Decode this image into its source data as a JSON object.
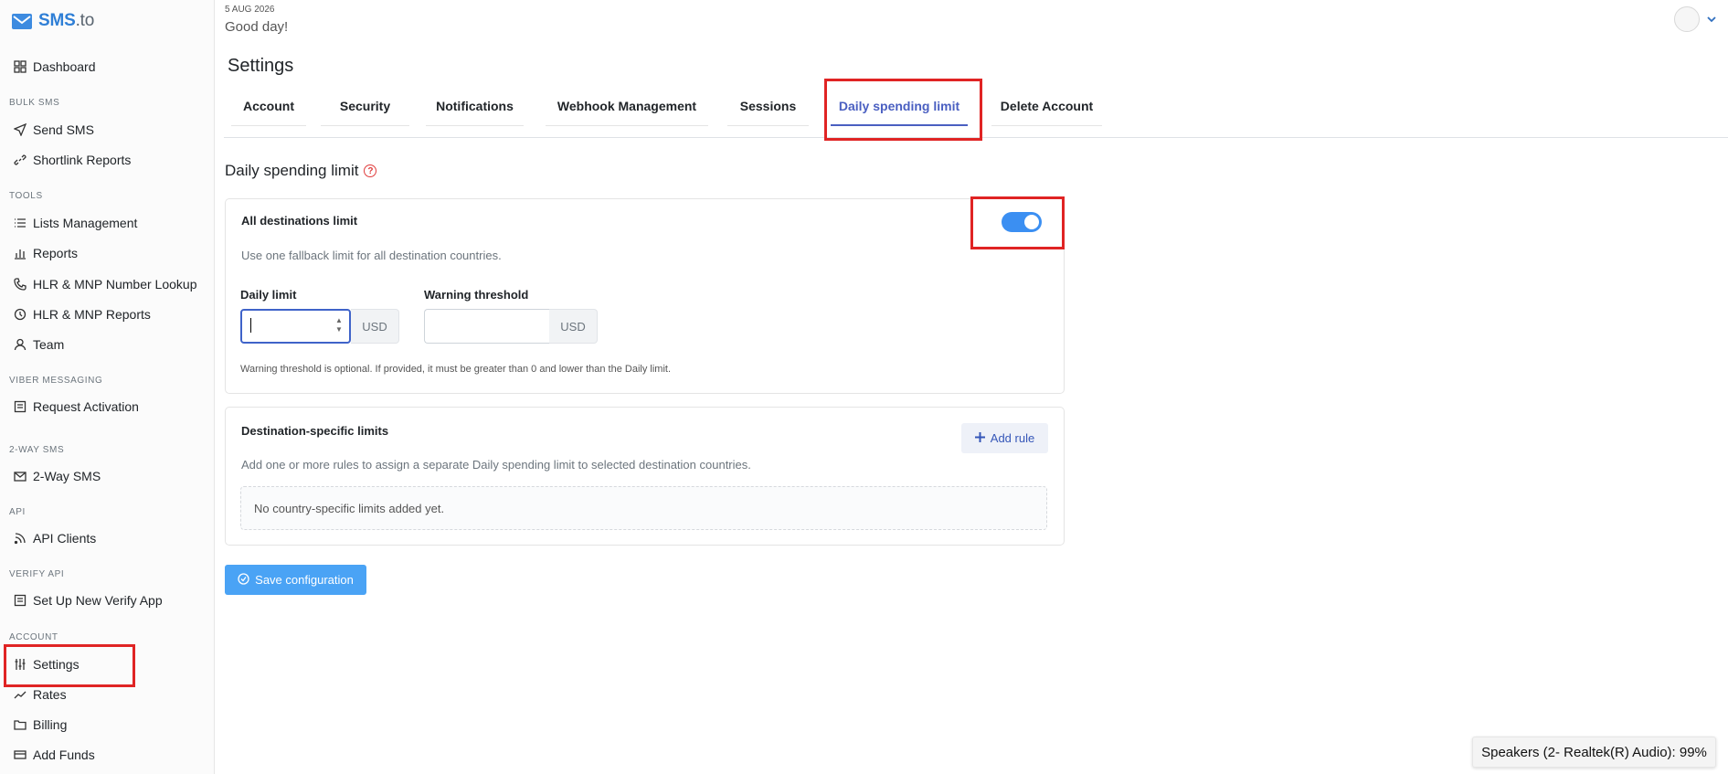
{
  "logo": {
    "brand": "SMS",
    "suffix": ".to",
    "icon": "envelope-icon"
  },
  "sidebar": {
    "dashboard": "Dashboard",
    "sections": {
      "bulk_sms": "BULK SMS",
      "tools": "TOOLS",
      "viber": "VIBER MESSAGING",
      "two_way": "2-WAY SMS",
      "api": "API",
      "verify": "VERIFY API",
      "account": "ACCOUNT"
    },
    "items": {
      "send_sms": "Send SMS",
      "shortlink_reports": "Shortlink Reports",
      "lists_management": "Lists Management",
      "reports": "Reports",
      "hlr_lookup": "HLR & MNP Number Lookup",
      "hlr_reports": "HLR & MNP Reports",
      "team": "Team",
      "request_activation": "Request Activation",
      "two_way_sms": "2-Way SMS",
      "api_clients": "API Clients",
      "verify_app": "Set Up New Verify App",
      "settings": "Settings",
      "rates": "Rates",
      "billing": "Billing",
      "add_funds": "Add Funds"
    }
  },
  "header": {
    "date": "5 AUG 2026",
    "greeting": "Good day!"
  },
  "page": {
    "title": "Settings",
    "tabs": [
      "Account",
      "Security",
      "Notifications",
      "Webhook Management",
      "Sessions",
      "Daily spending limit",
      "Delete Account"
    ],
    "active_tab": "Daily spending limit"
  },
  "spending": {
    "section_title": "Daily spending limit",
    "all_dest": {
      "title": "All destinations limit",
      "description": "Use one fallback limit for all destination countries.",
      "toggle_on": true,
      "daily_limit_label": "Daily limit",
      "daily_limit_value": "",
      "warning_label": "Warning threshold",
      "warning_value": "",
      "currency": "USD",
      "hint": "Warning threshold is optional. If provided, it must be greater than 0 and lower than the Daily limit."
    },
    "dest_specific": {
      "title": "Destination-specific limits",
      "description": "Add one or more rules to assign a separate Daily spending limit to selected destination countries.",
      "add_rule": "Add rule",
      "empty": "No country-specific limits added yet."
    },
    "save_label": "Save configuration"
  },
  "toast": {
    "text": "Speakers (2- Realtek(R) Audio): 99%"
  },
  "colors": {
    "accent": "#4a5fc1",
    "toggle": "#3b8ff2",
    "save": "#4aa3f5",
    "highlight": "#e02424"
  }
}
